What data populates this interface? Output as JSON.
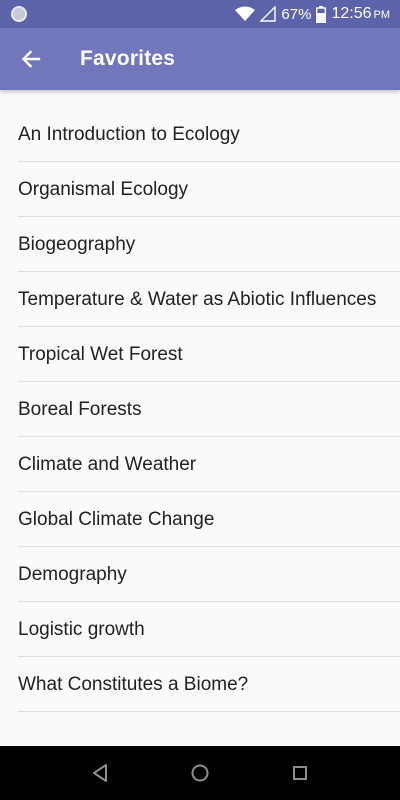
{
  "status_bar": {
    "battery_percent": "67%",
    "time": "12:56",
    "ampm": "PM",
    "icons": [
      "notification-circle-icon",
      "wifi-icon",
      "signal-icon",
      "battery-icon"
    ]
  },
  "app_bar": {
    "title": "Favorites",
    "back_icon": "arrow-left-icon"
  },
  "favorites": [
    "An Introduction to Ecology",
    "Organismal Ecology",
    "Biogeography",
    "Temperature & Water as Abiotic Influences",
    "Tropical Wet Forest",
    "Boreal Forests",
    "Climate and Weather",
    "Global Climate Change",
    "Demography",
    "Logistic growth",
    "What Constitutes a Biome?"
  ],
  "nav_bar": {
    "icons": [
      "back-triangle-icon",
      "home-circle-icon",
      "recents-square-icon"
    ]
  },
  "colors": {
    "status_bar": "#5d63a8",
    "app_bar": "#7277bb",
    "background": "#fafafa",
    "text": "#222222",
    "divider": "#dedede"
  }
}
